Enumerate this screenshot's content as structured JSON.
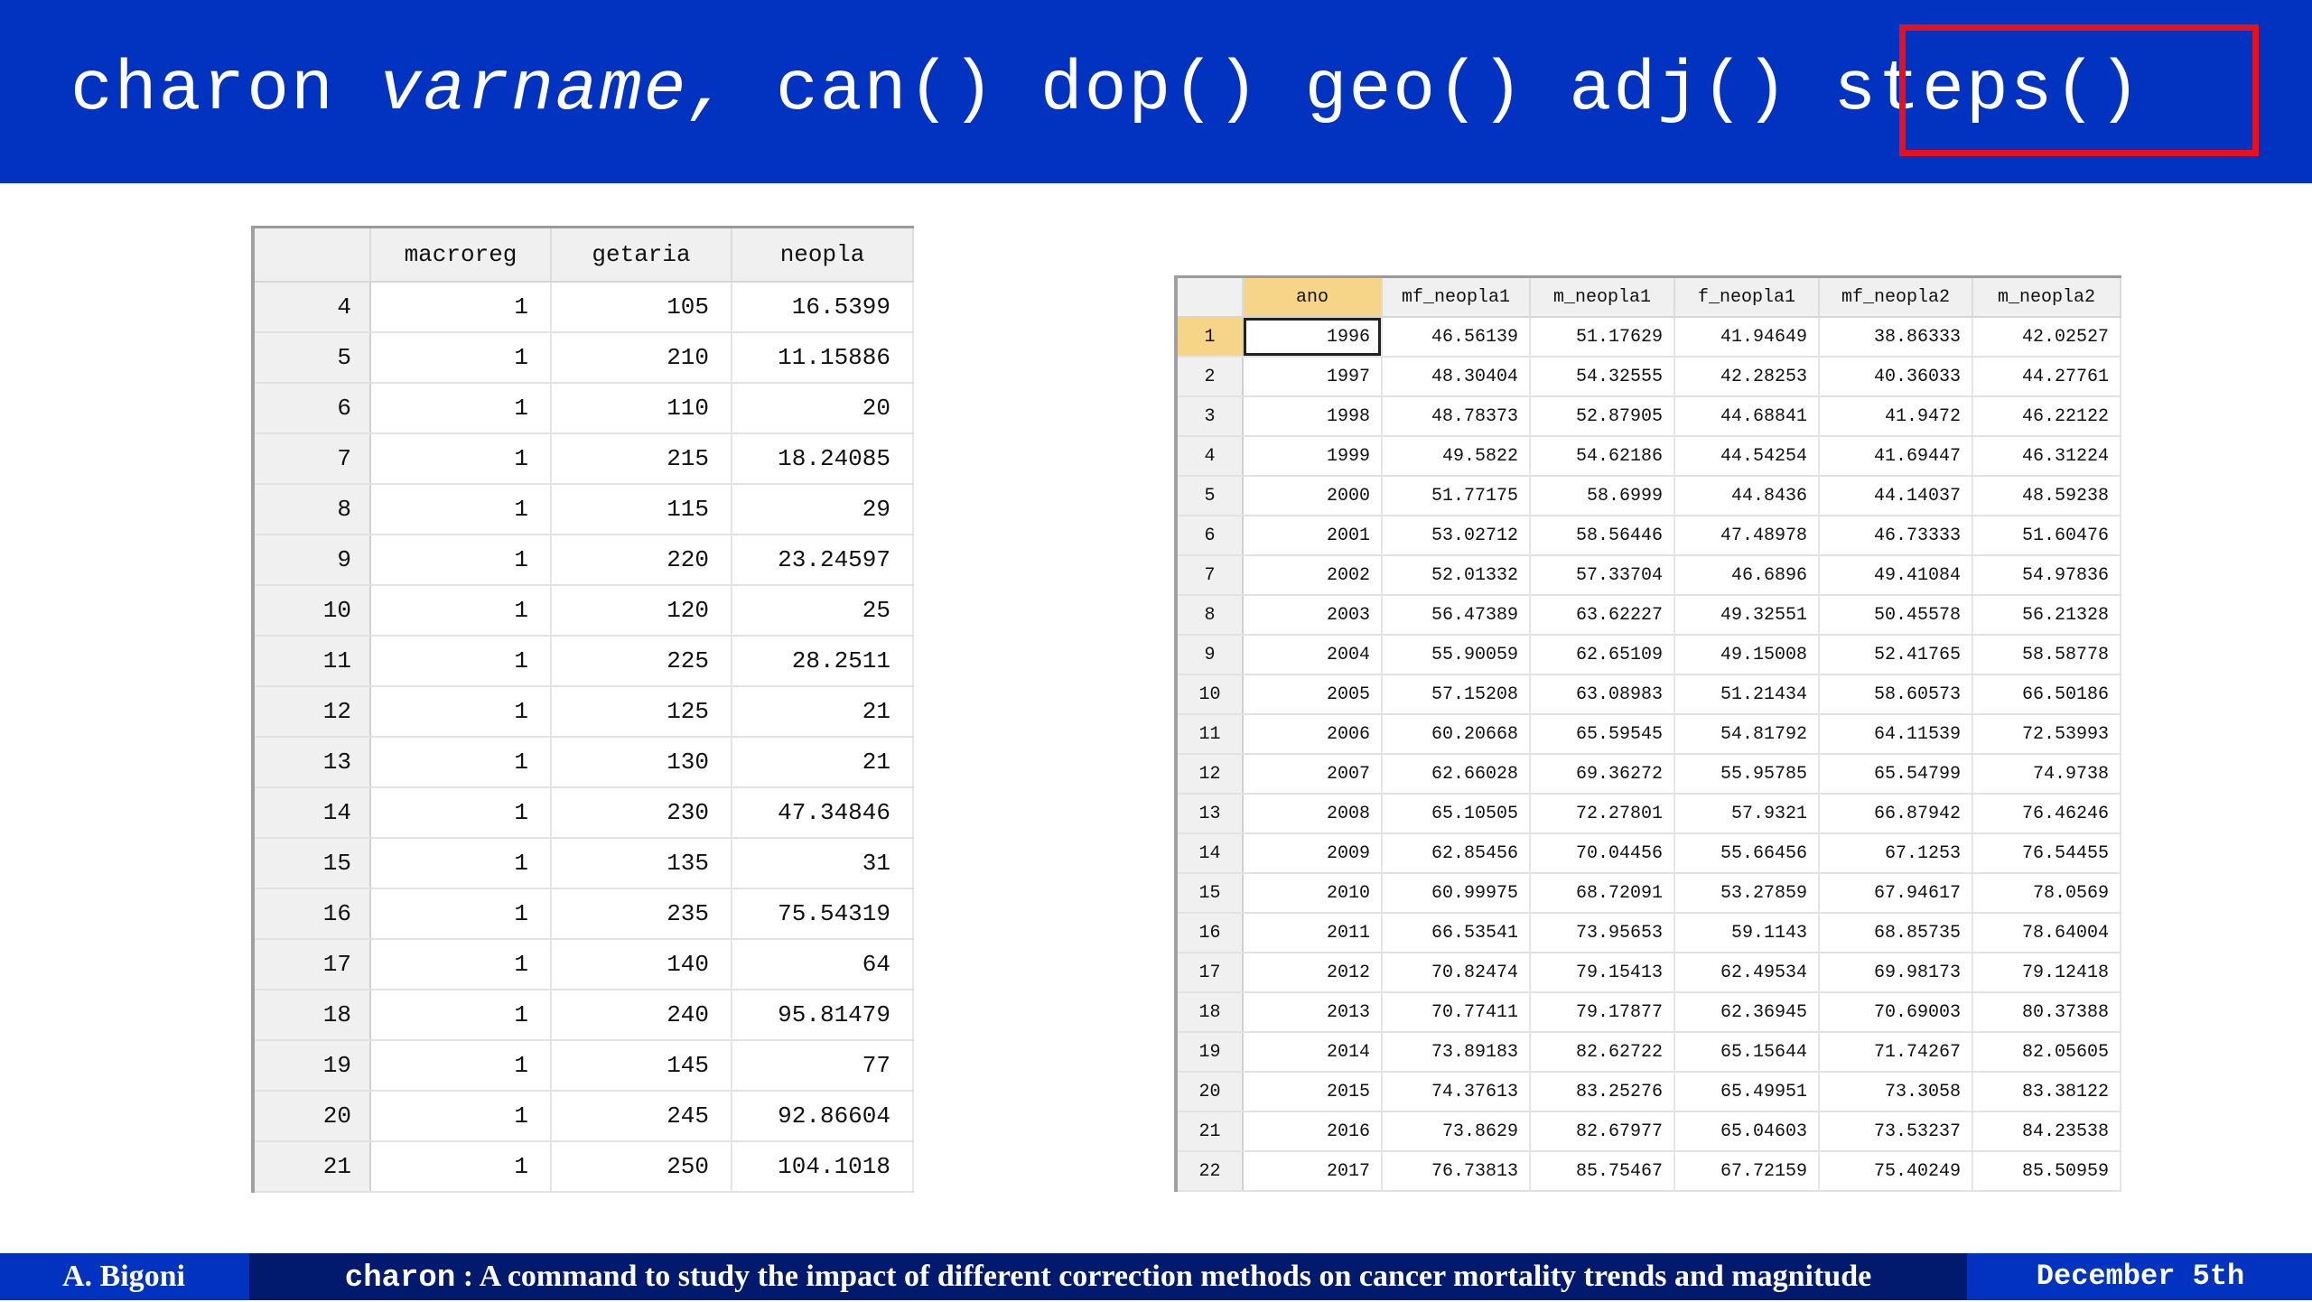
{
  "header": {
    "cmd_name": "charon",
    "cmd_var": "varname,",
    "options": [
      "can()",
      "dop()",
      "geo()",
      "adj()"
    ],
    "highlighted_option": "steps()"
  },
  "left_table": {
    "columns": [
      "macroreg",
      "getaria",
      "neopla"
    ],
    "rows": [
      [
        "4",
        "1",
        "105",
        "16.5399"
      ],
      [
        "5",
        "1",
        "210",
        "11.15886"
      ],
      [
        "6",
        "1",
        "110",
        "20"
      ],
      [
        "7",
        "1",
        "215",
        "18.24085"
      ],
      [
        "8",
        "1",
        "115",
        "29"
      ],
      [
        "9",
        "1",
        "220",
        "23.24597"
      ],
      [
        "10",
        "1",
        "120",
        "25"
      ],
      [
        "11",
        "1",
        "225",
        "28.2511"
      ],
      [
        "12",
        "1",
        "125",
        "21"
      ],
      [
        "13",
        "1",
        "130",
        "21"
      ],
      [
        "14",
        "1",
        "230",
        "47.34846"
      ],
      [
        "15",
        "1",
        "135",
        "31"
      ],
      [
        "16",
        "1",
        "235",
        "75.54319"
      ],
      [
        "17",
        "1",
        "140",
        "64"
      ],
      [
        "18",
        "1",
        "240",
        "95.81479"
      ],
      [
        "19",
        "1",
        "145",
        "77"
      ],
      [
        "20",
        "1",
        "245",
        "92.86604"
      ],
      [
        "21",
        "1",
        "250",
        "104.1018"
      ]
    ]
  },
  "right_table": {
    "columns": [
      "ano",
      "mf_neopla1",
      "m_neopla1",
      "f_neopla1",
      "mf_neopla2",
      "m_neopla2"
    ],
    "rows": [
      [
        "1",
        "1996",
        "46.56139",
        "51.17629",
        "41.94649",
        "38.86333",
        "42.02527"
      ],
      [
        "2",
        "1997",
        "48.30404",
        "54.32555",
        "42.28253",
        "40.36033",
        "44.27761"
      ],
      [
        "3",
        "1998",
        "48.78373",
        "52.87905",
        "44.68841",
        "41.9472",
        "46.22122"
      ],
      [
        "4",
        "1999",
        "49.5822",
        "54.62186",
        "44.54254",
        "41.69447",
        "46.31224"
      ],
      [
        "5",
        "2000",
        "51.77175",
        "58.6999",
        "44.8436",
        "44.14037",
        "48.59238"
      ],
      [
        "6",
        "2001",
        "53.02712",
        "58.56446",
        "47.48978",
        "46.73333",
        "51.60476"
      ],
      [
        "7",
        "2002",
        "52.01332",
        "57.33704",
        "46.6896",
        "49.41084",
        "54.97836"
      ],
      [
        "8",
        "2003",
        "56.47389",
        "63.62227",
        "49.32551",
        "50.45578",
        "56.21328"
      ],
      [
        "9",
        "2004",
        "55.90059",
        "62.65109",
        "49.15008",
        "52.41765",
        "58.58778"
      ],
      [
        "10",
        "2005",
        "57.15208",
        "63.08983",
        "51.21434",
        "58.60573",
        "66.50186"
      ],
      [
        "11",
        "2006",
        "60.20668",
        "65.59545",
        "54.81792",
        "64.11539",
        "72.53993"
      ],
      [
        "12",
        "2007",
        "62.66028",
        "69.36272",
        "55.95785",
        "65.54799",
        "74.9738"
      ],
      [
        "13",
        "2008",
        "65.10505",
        "72.27801",
        "57.9321",
        "66.87942",
        "76.46246"
      ],
      [
        "14",
        "2009",
        "62.85456",
        "70.04456",
        "55.66456",
        "67.1253",
        "76.54455"
      ],
      [
        "15",
        "2010",
        "60.99975",
        "68.72091",
        "53.27859",
        "67.94617",
        "78.0569"
      ],
      [
        "16",
        "2011",
        "66.53541",
        "73.95653",
        "59.1143",
        "68.85735",
        "78.64004"
      ],
      [
        "17",
        "2012",
        "70.82474",
        "79.15413",
        "62.49534",
        "69.98173",
        "79.12418"
      ],
      [
        "18",
        "2013",
        "70.77411",
        "79.17877",
        "62.36945",
        "70.69003",
        "80.37388"
      ],
      [
        "19",
        "2014",
        "73.89183",
        "82.62722",
        "65.15644",
        "71.74267",
        "82.05605"
      ],
      [
        "20",
        "2015",
        "74.37613",
        "83.25276",
        "65.49951",
        "73.3058",
        "83.38122"
      ],
      [
        "21",
        "2016",
        "73.8629",
        "82.67977",
        "65.04603",
        "73.53237",
        "84.23538"
      ],
      [
        "22",
        "2017",
        "76.73813",
        "85.75467",
        "67.72159",
        "75.40249",
        "85.50959"
      ]
    ]
  },
  "footer": {
    "author": "A. Bigoni",
    "cmd": "charon",
    "title": " : A command to study the impact of different correction methods on cancer mortality trends and magnitude",
    "date": "December 5th"
  }
}
